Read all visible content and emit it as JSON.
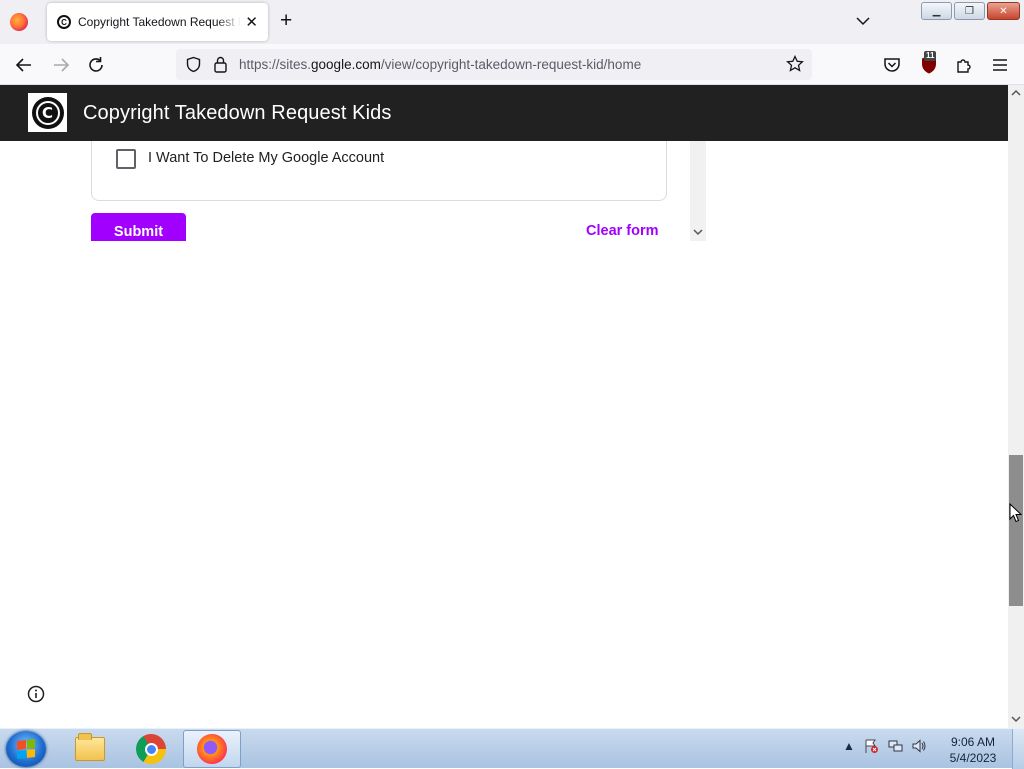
{
  "browser": {
    "tab": {
      "title": "Copyright Takedown Request Kids",
      "favicon": "copyright-icon"
    },
    "url": {
      "prefix": "https://sites.",
      "domain": "google.com",
      "path": "/view/copyright-takedown-request-kid/home"
    },
    "extension_badge": "11"
  },
  "site": {
    "title": "Copyright Takedown Request Kids",
    "logo": "copyright-logo"
  },
  "form": {
    "checkbox_label": "I Want To Delete My Google Account",
    "checkbox_checked": false,
    "submit_label": "Submit",
    "clear_label": "Clear form",
    "accent_color": "#a100ff"
  },
  "taskbar": {
    "apps": [
      "windows-explorer",
      "google-chrome",
      "firefox"
    ],
    "active_app": "firefox",
    "clock": {
      "time": "9:06 AM",
      "date": "5/4/2023"
    }
  },
  "colors": {
    "header_bg": "#212121",
    "accent": "#a100ff"
  }
}
